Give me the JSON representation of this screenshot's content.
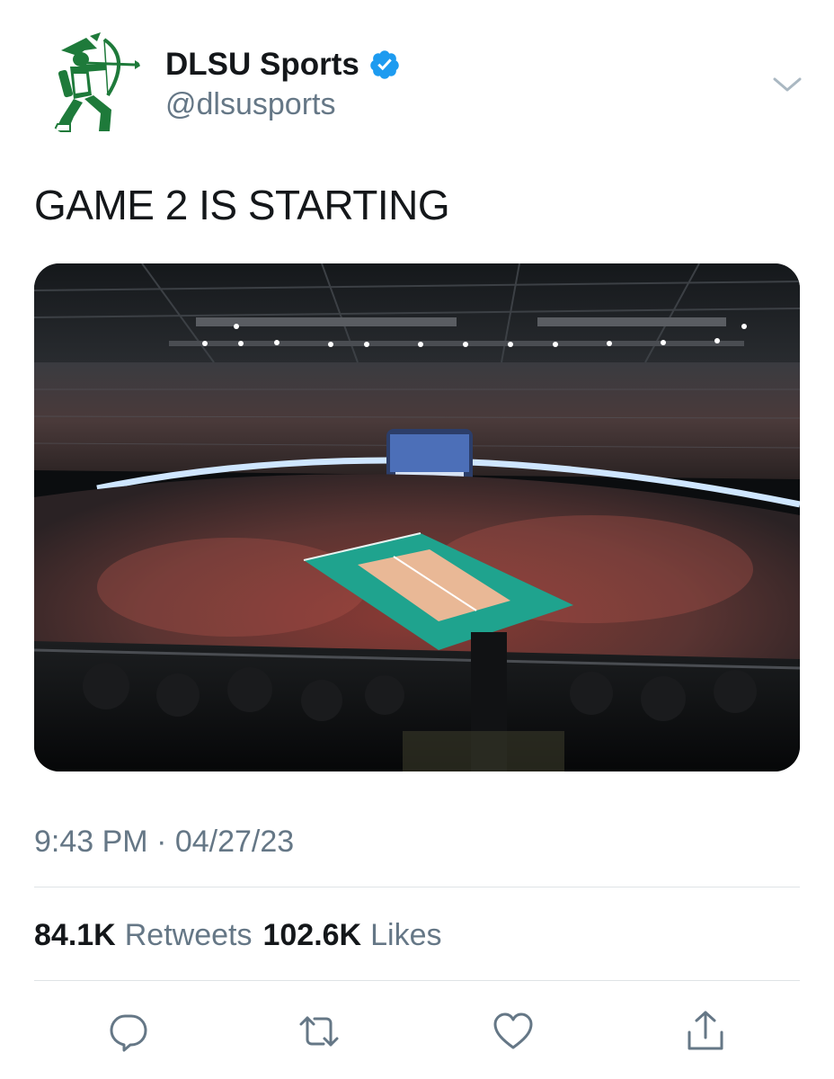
{
  "tweet": {
    "author": {
      "display_name": "DLSU Sports",
      "handle": "@dlsusports",
      "verified": true,
      "avatar_icon": "green-archer-logo-icon"
    },
    "text": "GAME 2 IS STARTING",
    "media": {
      "type": "photo",
      "subject": "arena-volleyball-court-photo"
    },
    "timestamp": "9:43 PM · 04/27/23",
    "stats": {
      "retweets_count": "84.1K",
      "retweets_label": "Retweets",
      "likes_count": "102.6K",
      "likes_label": "Likes"
    },
    "actions": [
      {
        "name": "reply-icon"
      },
      {
        "name": "retweet-icon"
      },
      {
        "name": "like-icon"
      },
      {
        "name": "share-icon"
      }
    ]
  },
  "colors": {
    "text_primary": "#14171a",
    "text_secondary": "#657786",
    "verified_blue": "#1d9bf0",
    "divider": "#dfe3e6",
    "logo_green": "#1e7a3a",
    "court_teal": "#1fa38e",
    "court_sand": "#e9b896"
  }
}
